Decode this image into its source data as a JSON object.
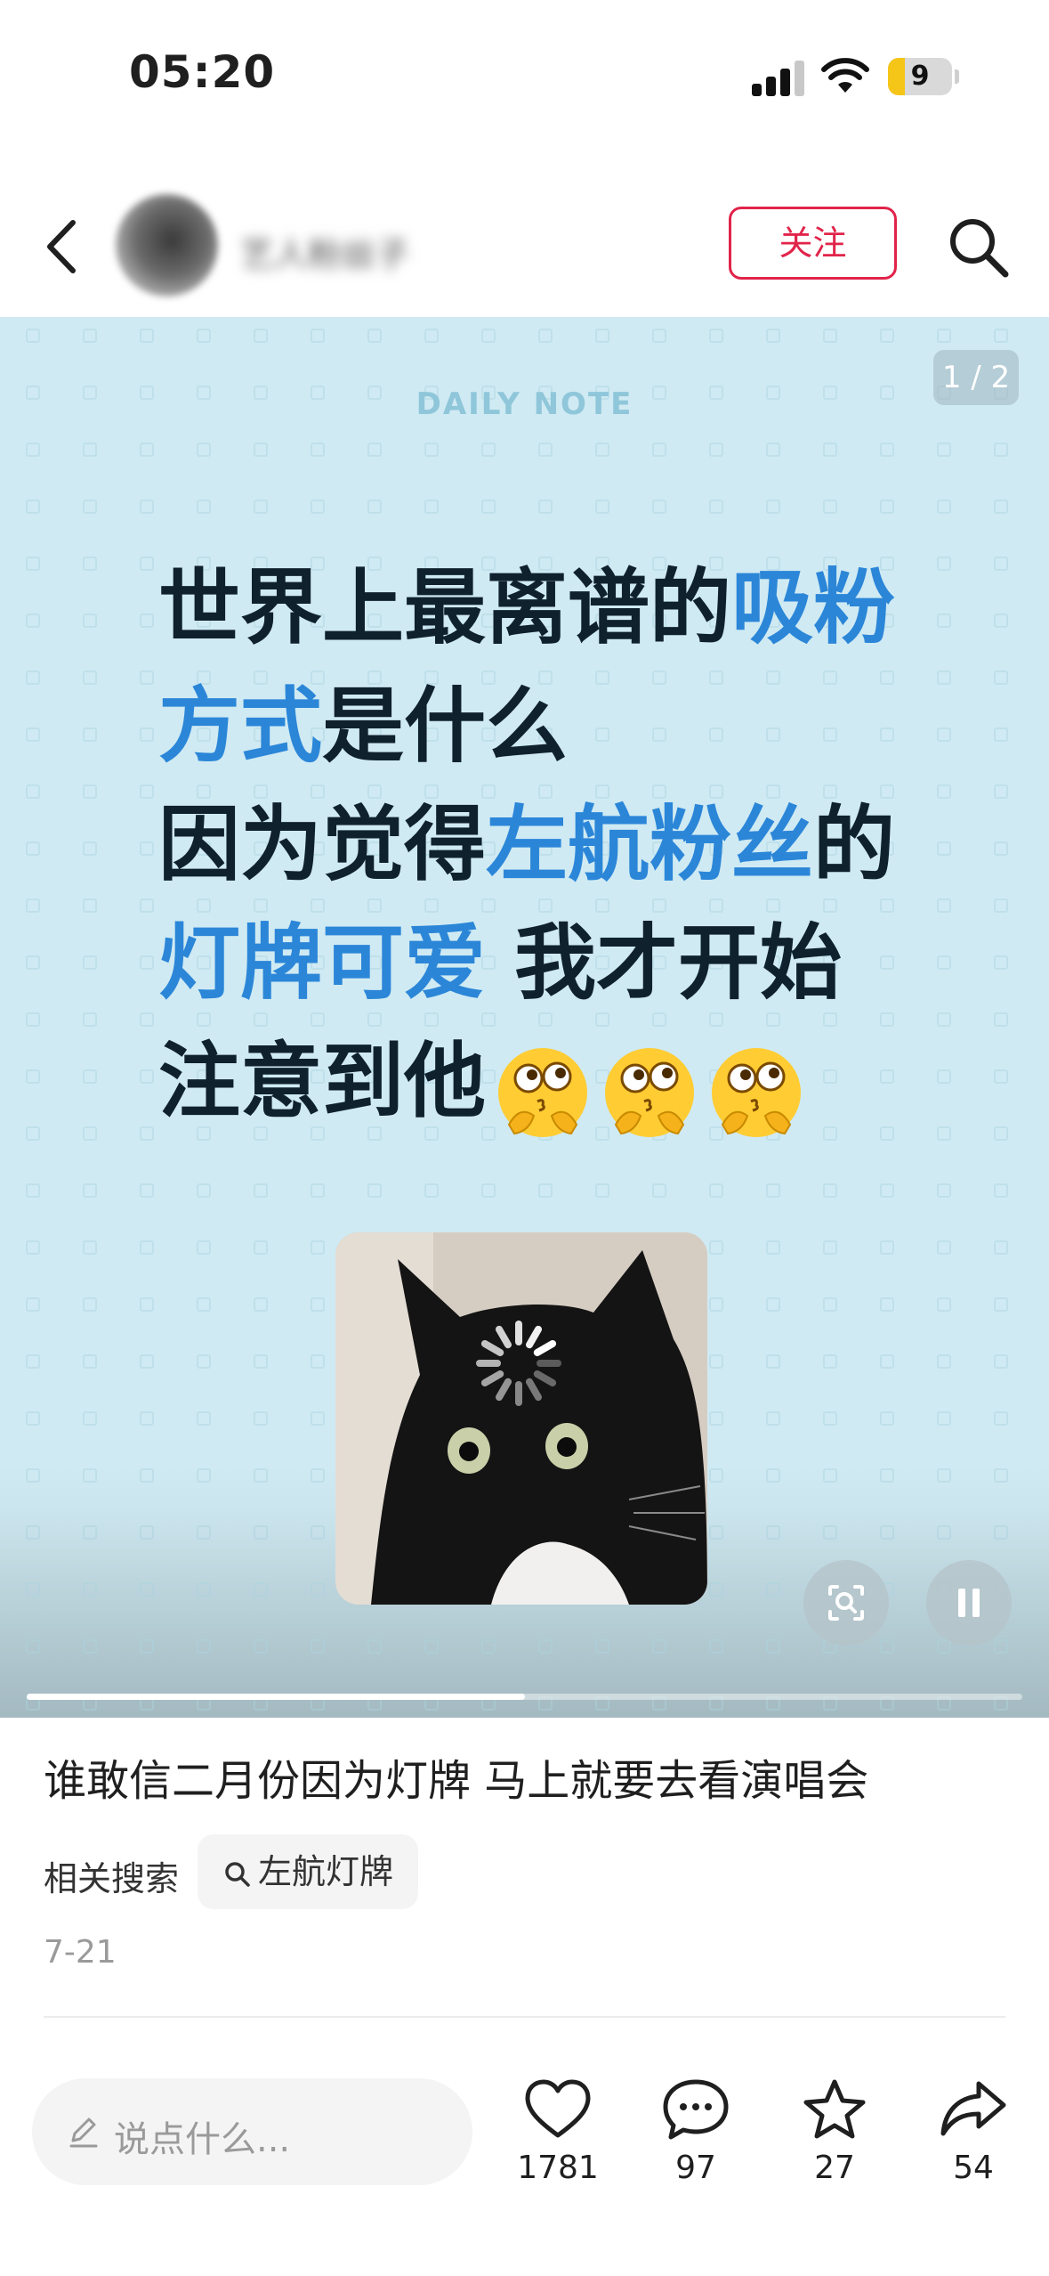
{
  "status_bar": {
    "time": "05:20",
    "battery": "9",
    "battery_level": 0.09
  },
  "nav": {
    "follow_label": "关注",
    "username": "艺人粉丝子"
  },
  "post": {
    "page_indicator": "1 / 2",
    "daily_note": "DAILY NOTE",
    "headline": {
      "l1a": "世界上最离谱的",
      "l1b": "吸粉",
      "l2a": "方式",
      "l2b": "是什么",
      "l3a": "因为觉得",
      "l3b": "左航粉丝",
      "l3c": "的",
      "l4a": "灯牌可爱",
      "l4b": " 我才开始",
      "l5a": "注意到他"
    },
    "emoji": "thinking-kiss-face",
    "progress": 0.5
  },
  "caption": "谁敢信二月份因为灯牌 马上就要去看演唱会",
  "related": {
    "label": "相关搜索",
    "tag": "左航灯牌"
  },
  "date": "7-21",
  "bottom_bar": {
    "comment_placeholder": "说点什么...",
    "likes": "1781",
    "comments": "97",
    "favorites": "27",
    "shares": "54"
  }
}
